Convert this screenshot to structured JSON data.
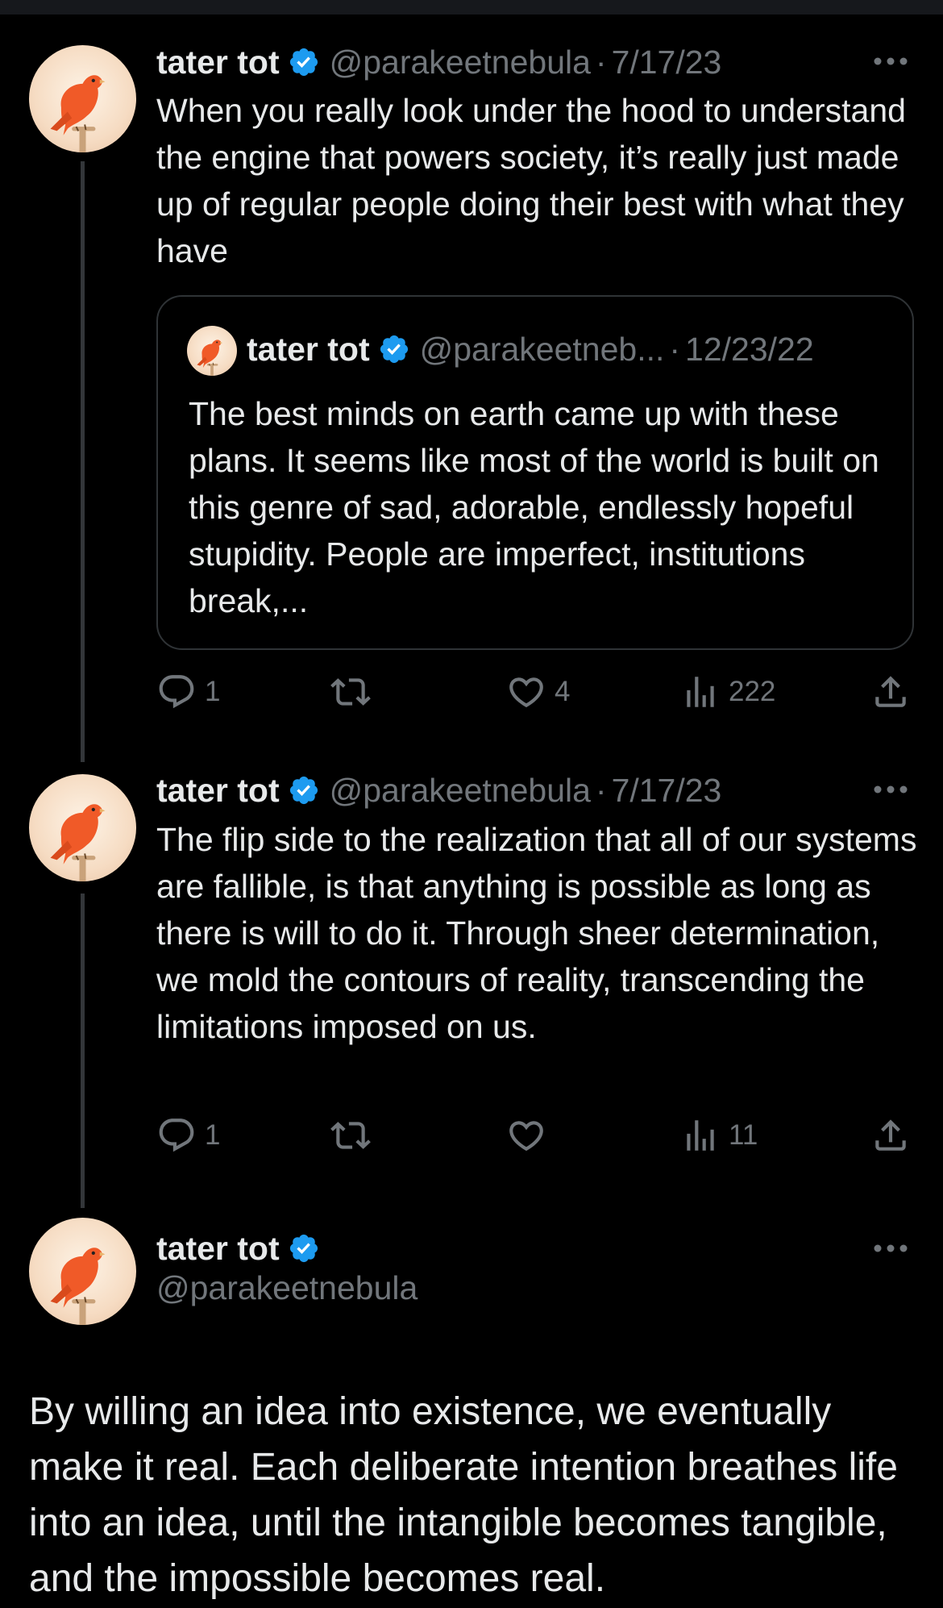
{
  "colors": {
    "background": "#000000",
    "text": "#e7e9ea",
    "muted": "#71767b",
    "verified": "#1d9bf0",
    "border": "#2f3336"
  },
  "tweets": [
    {
      "name": "tater tot",
      "handle": "@parakeetnebula",
      "dot": "·",
      "date": "7/17/23",
      "text": "When you really look under the hood to understand the engine that powers society, it’s really just made up of regular people doing their best with what they have",
      "quote": {
        "name": "tater tot",
        "handle": "@parakeetneb...",
        "dot": "·",
        "date": "12/23/22",
        "text": "The best minds on earth came up with these plans. It seems like most of the world is built on this genre of sad, adorable, endlessly hopeful stupidity. People are imperfect, institutions break,..."
      },
      "replies": "1",
      "reposts": "",
      "likes": "4",
      "views": "222"
    },
    {
      "name": "tater tot",
      "handle": "@parakeetnebula",
      "dot": "·",
      "date": "7/17/23",
      "text": "The flip side to the realization that all of our systems are fallible, is that anything is possible as long as there is will to do it. Through sheer determination, we mold the contours of reality, transcending the limitations imposed on us.",
      "replies": "1",
      "reposts": "",
      "likes": "",
      "views": "11"
    }
  ],
  "main_tweet": {
    "name": "tater tot",
    "handle": "@parakeetnebula",
    "text": "By willing an idea into existence, we eventually make it real. Each deliberate intention breathes life into an idea, until the intangible becomes tangible, and the impossible becomes real."
  },
  "icons": [
    "verified-badge-icon",
    "more-icon",
    "reply-icon",
    "repost-icon",
    "like-icon",
    "views-icon",
    "share-icon",
    "avatar-canary"
  ]
}
